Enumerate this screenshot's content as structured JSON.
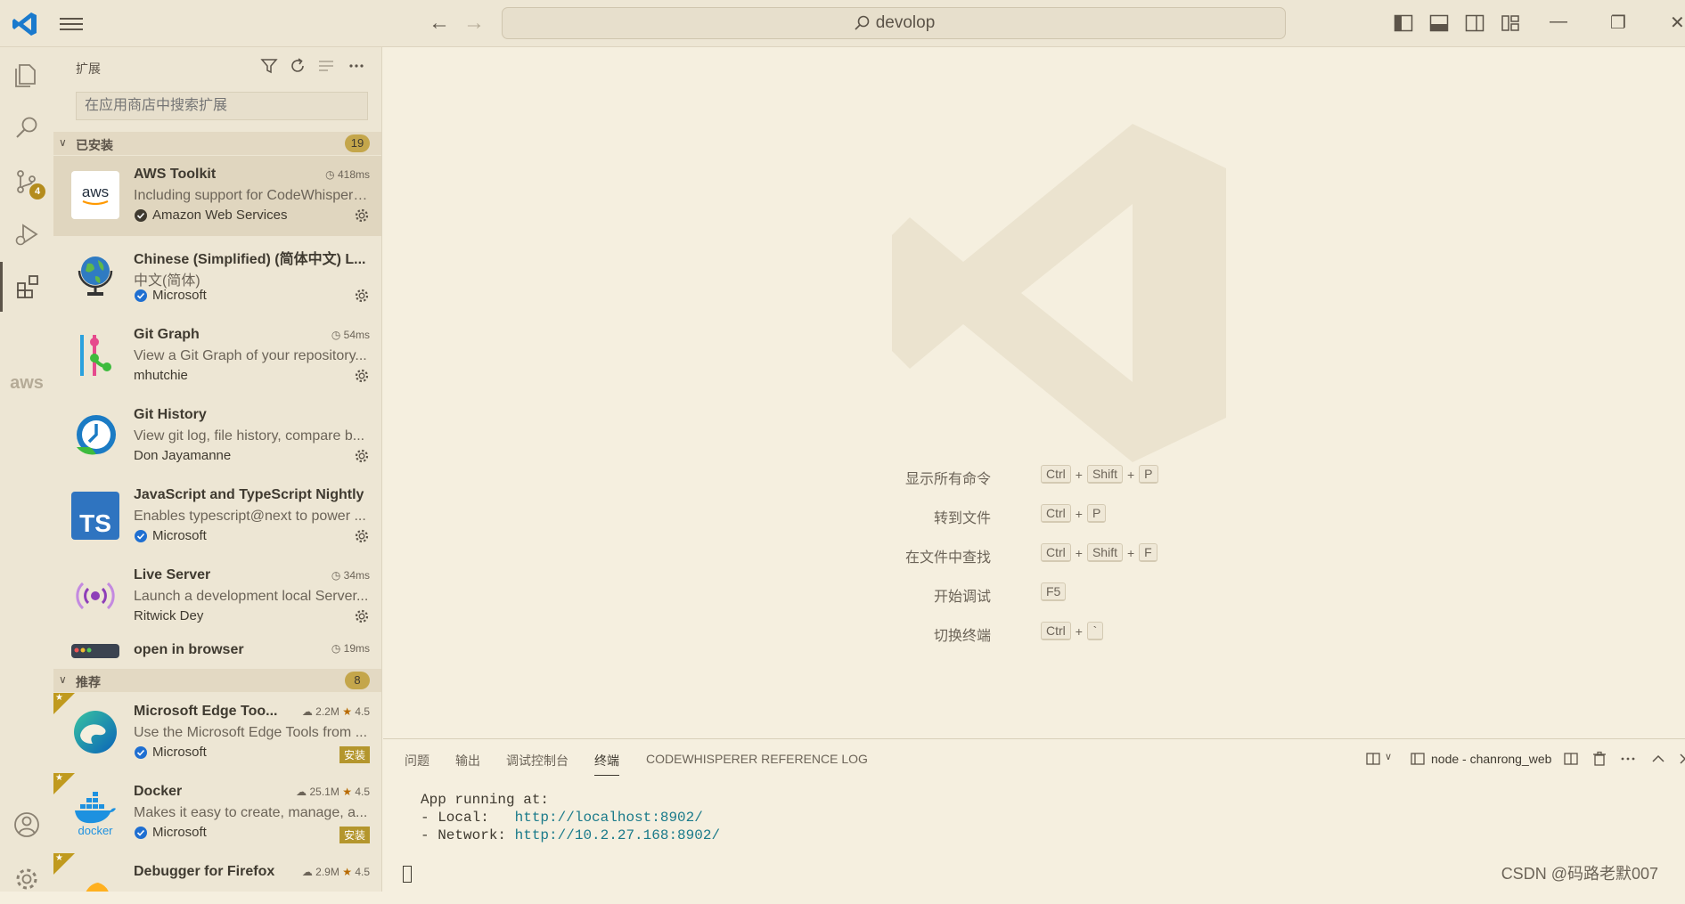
{
  "titlebar": {
    "search_text": "devolop"
  },
  "activitybar": {
    "scm_badge": "4",
    "aws_label": "aws"
  },
  "sidebar": {
    "title": "扩展",
    "search_placeholder": "在应用商店中搜索扩展",
    "installed": {
      "label": "已安装",
      "count": "19",
      "items": [
        {
          "name": "AWS Toolkit",
          "desc": "Including support for CodeWhisperer...",
          "publisher": "Amazon Web Services",
          "timing": "418ms",
          "verified": true
        },
        {
          "name": "Chinese (Simplified) (简体中文) L...",
          "desc": "中文(简体)",
          "publisher": "Microsoft",
          "timing": "",
          "verified": true
        },
        {
          "name": "Git Graph",
          "desc": "View a Git Graph of your repository...",
          "publisher": "mhutchie",
          "timing": "54ms",
          "verified": false
        },
        {
          "name": "Git History",
          "desc": "View git log, file history, compare b...",
          "publisher": "Don Jayamanne",
          "timing": "",
          "verified": false
        },
        {
          "name": "JavaScript and TypeScript Nightly",
          "desc": "Enables typescript@next to power ...",
          "publisher": "Microsoft",
          "timing": "",
          "verified": true
        },
        {
          "name": "Live Server",
          "desc": "Launch a development local Server...",
          "publisher": "Ritwick Dey",
          "timing": "34ms",
          "verified": false
        },
        {
          "name": "open in browser",
          "desc": "",
          "publisher": "",
          "timing": "19ms",
          "verified": false
        }
      ]
    },
    "recommended": {
      "label": "推荐",
      "count": "8",
      "install_label": "安装",
      "items": [
        {
          "name": "Microsoft Edge Too...",
          "desc": "Use the Microsoft Edge Tools from ...",
          "publisher": "Microsoft",
          "downloads": "2.2M",
          "rating": "4.5"
        },
        {
          "name": "Docker",
          "desc": "Makes it easy to create, manage, a...",
          "publisher": "Microsoft",
          "downloads": "25.1M",
          "rating": "4.5"
        },
        {
          "name": "Debugger for Firefox",
          "desc": "",
          "publisher": "",
          "downloads": "2.9M",
          "rating": "4.5"
        }
      ]
    }
  },
  "editor": {
    "shortcuts": [
      {
        "label": "显示所有命令",
        "keys": [
          "Ctrl",
          "Shift",
          "P"
        ]
      },
      {
        "label": "转到文件",
        "keys": [
          "Ctrl",
          "P"
        ]
      },
      {
        "label": "在文件中查找",
        "keys": [
          "Ctrl",
          "Shift",
          "F"
        ]
      },
      {
        "label": "开始调试",
        "keys": [
          "F5"
        ]
      },
      {
        "label": "切换终端",
        "keys": [
          "Ctrl",
          "`"
        ]
      }
    ]
  },
  "panel": {
    "tabs": [
      "问题",
      "输出",
      "调试控制台",
      "终端",
      "CODEWHISPERER REFERENCE LOG"
    ],
    "active_tab": "终端",
    "terminal_name": "node - chanrong_web",
    "terminal": {
      "line1": "App running at:",
      "local_prefix": "- Local:   ",
      "local_url": "http://localhost:8902/",
      "network_prefix": "- Network: ",
      "network_url": "http://10.2.27.168:8902/"
    }
  },
  "watermark_text": "CSDN @码路老默007"
}
